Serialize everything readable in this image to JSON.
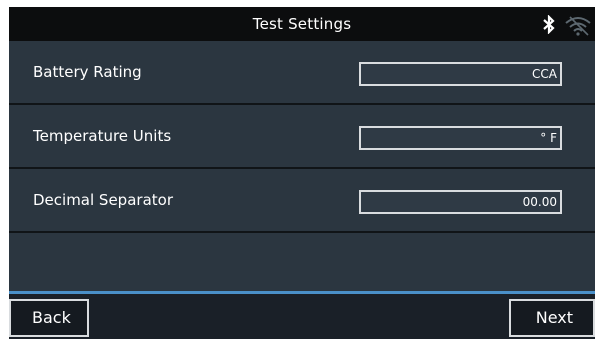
{
  "header": {
    "title": "Test Settings",
    "icons": [
      "bluetooth-icon",
      "wifi-icon"
    ]
  },
  "settings": [
    {
      "label": "Battery Rating",
      "value": "CCA"
    },
    {
      "label": "Temperature Units",
      "value": "° F"
    },
    {
      "label": "Decimal Separator",
      "value": "00.00"
    }
  ],
  "footer": {
    "back_label": "Back",
    "next_label": "Next"
  },
  "colors": {
    "background": "#2b3640",
    "header": "#0c0d0e",
    "accent": "#4a90c9",
    "border": "#d9dcdf"
  }
}
